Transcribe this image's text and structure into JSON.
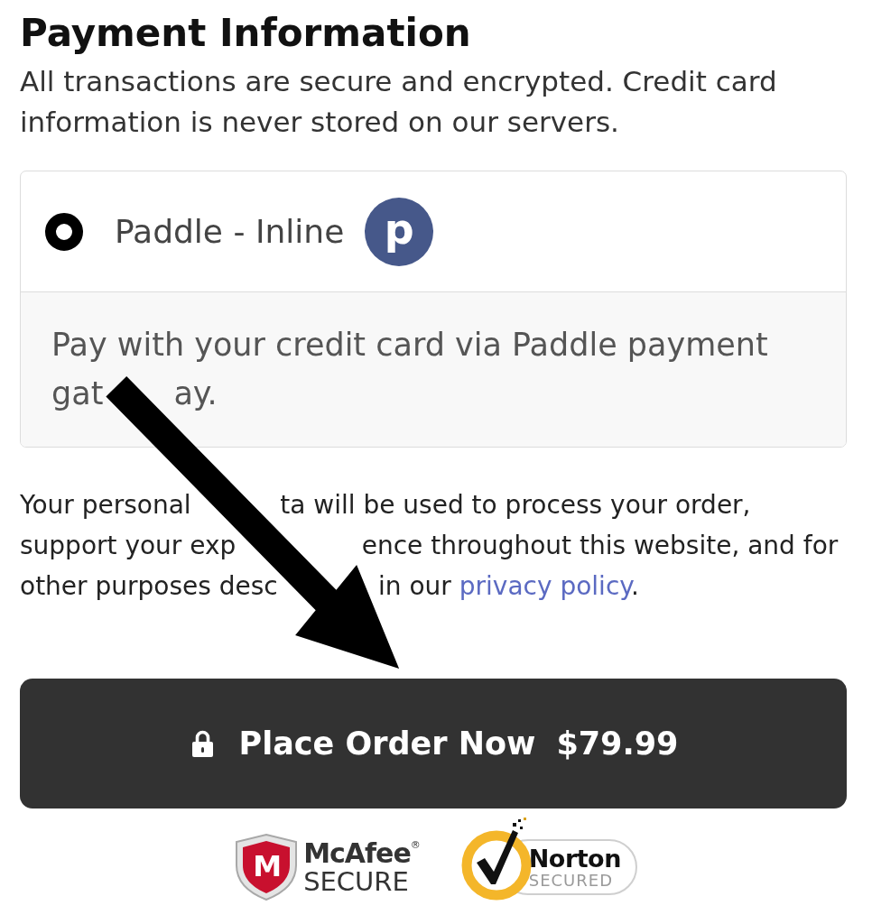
{
  "heading": {
    "title": "Payment Information",
    "subtitle": "All transactions are secure and encrypted. Credit card information is never stored on our servers."
  },
  "payment_methods": [
    {
      "label": "Paddle - Inline",
      "selected": true,
      "logo_letter": "p",
      "description": [
        "Pay with your credit card via Paddle payment gat",
        "ay."
      ]
    }
  ],
  "privacy_notice": {
    "segments": [
      "Your personal",
      "ta will be used to process your order, support your exp",
      "ence throughout this website, and for other purposes desc",
      "in our"
    ],
    "link": "privacy policy",
    "after": "."
  },
  "place_order_button": {
    "label": "Place Order Now",
    "price": "$79.99"
  },
  "trust_badges": [
    {
      "kind": "mcafee",
      "mark_letter": "M",
      "name": "McAfee$^{®}$",
      "caption": "SECURE"
    },
    {
      "kind": "norton",
      "name": "Norton",
      "caption": "SECURED"
    }
  ]
}
